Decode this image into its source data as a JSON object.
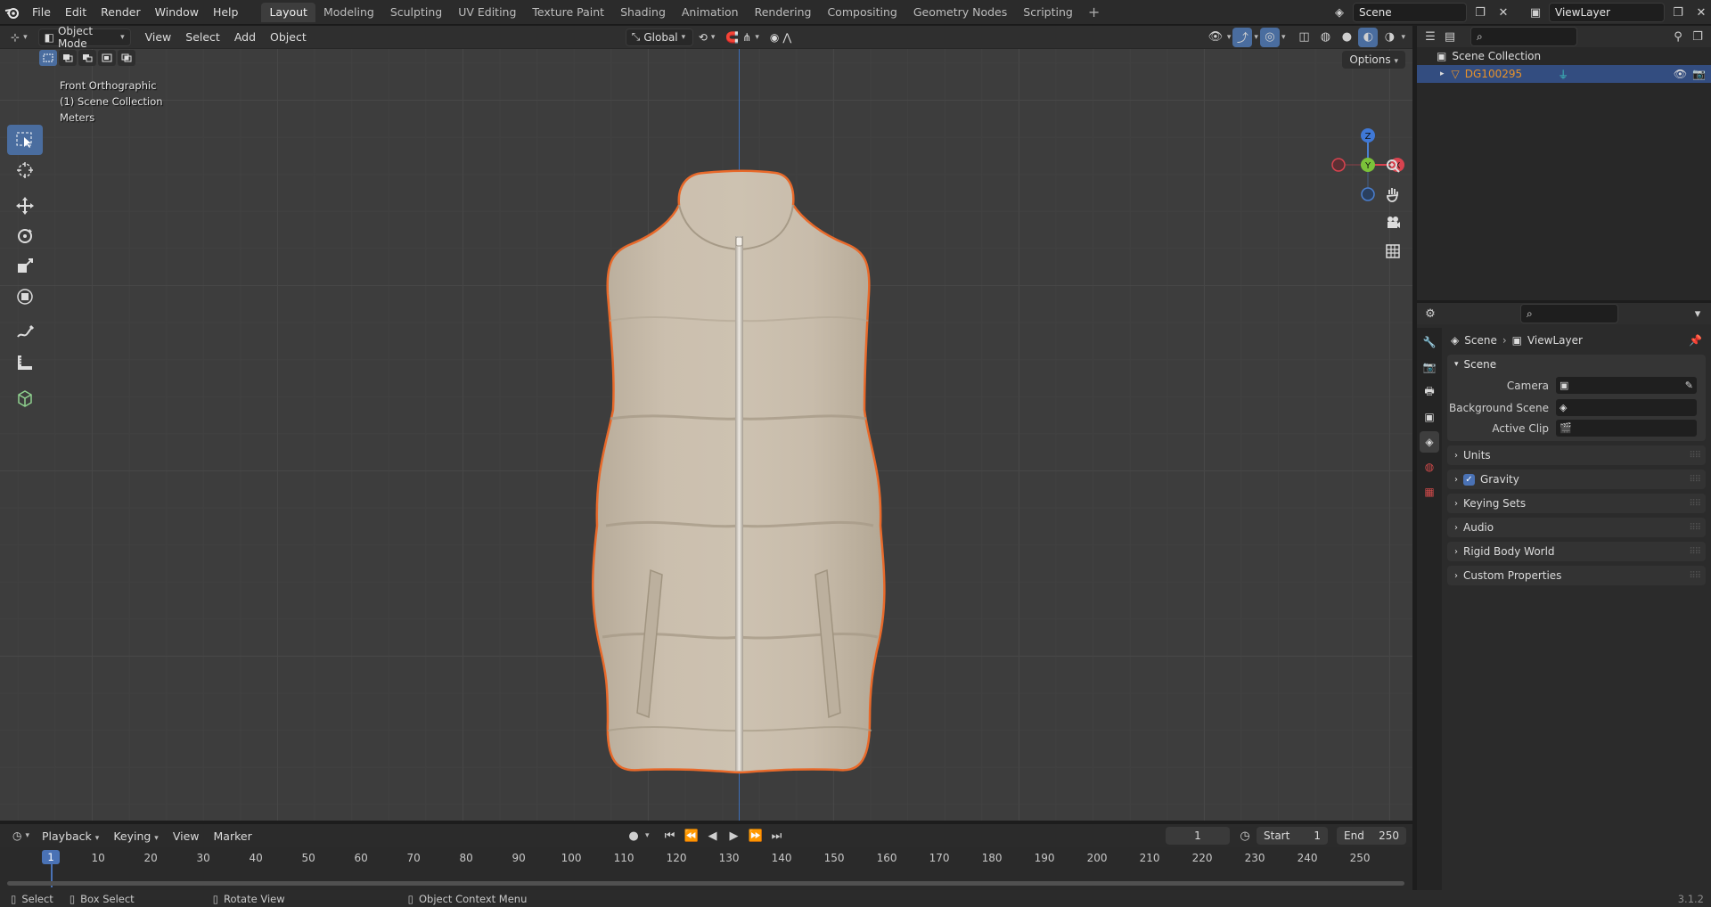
{
  "topbar": {
    "menus": [
      "File",
      "Edit",
      "Render",
      "Window",
      "Help"
    ],
    "workspaces": [
      "Layout",
      "Modeling",
      "Sculpting",
      "UV Editing",
      "Texture Paint",
      "Shading",
      "Animation",
      "Rendering",
      "Compositing",
      "Geometry Nodes",
      "Scripting"
    ],
    "active_workspace": "Layout",
    "scene_name": "Scene",
    "view_layer_name": "ViewLayer"
  },
  "viewport_header": {
    "mode": "Object Mode",
    "menus": [
      "View",
      "Select",
      "Add",
      "Object"
    ],
    "orientation": "Global",
    "options_label": "Options"
  },
  "viewport": {
    "view_name": "Front Orthographic",
    "collection_info": "(1) Scene Collection",
    "units": "Meters",
    "gizmo_axes": {
      "z": "Z",
      "y": "Y",
      "x": "X"
    },
    "object_outline_color": "#e8692a",
    "axis_line_color": "#3d6fb8"
  },
  "timeline": {
    "menus": [
      "Playback",
      "Keying",
      "View",
      "Marker"
    ],
    "current_frame": "1",
    "start_label": "Start",
    "start_value": "1",
    "end_label": "End",
    "end_value": "250",
    "ticks": [
      "1",
      "10",
      "20",
      "30",
      "40",
      "50",
      "60",
      "70",
      "80",
      "90",
      "100",
      "110",
      "120",
      "130",
      "140",
      "150",
      "160",
      "170",
      "180",
      "190",
      "200",
      "210",
      "220",
      "230",
      "240",
      "250"
    ]
  },
  "statusbar": {
    "select": "Select",
    "box_select": "Box Select",
    "rotate_view": "Rotate View",
    "context_menu": "Object Context Menu",
    "version": "3.1.2"
  },
  "outliner": {
    "root": "Scene Collection",
    "object_name": "DG100295"
  },
  "properties": {
    "breadcrumb_scene": "Scene",
    "breadcrumb_viewlayer": "ViewLayer",
    "scene_panel": "Scene",
    "camera_label": "Camera",
    "background_scene_label": "Background Scene",
    "active_clip_label": "Active Clip",
    "panels": [
      "Units",
      "Gravity",
      "Keying Sets",
      "Audio",
      "Rigid Body World",
      "Custom Properties"
    ]
  }
}
